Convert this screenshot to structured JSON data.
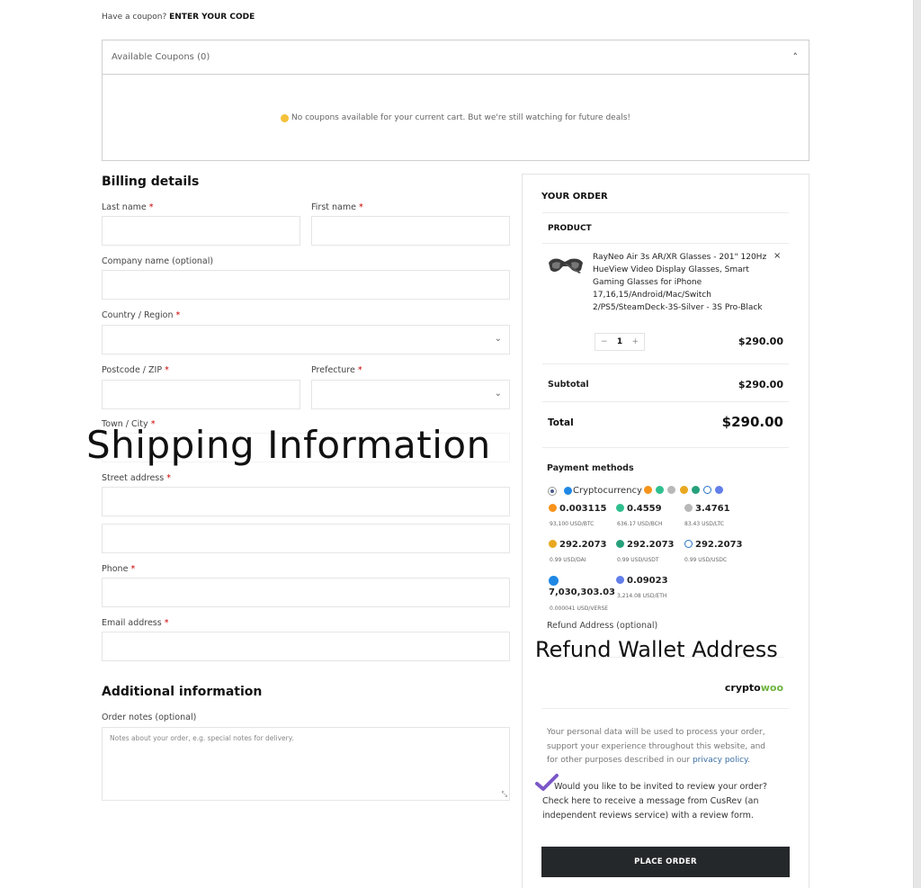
{
  "coupon": {
    "prompt": "Have a coupon?",
    "link": "ENTER YOUR CODE",
    "available_label": "Available Coupons (0)",
    "empty_message": "No coupons available for your current cart. But we're still watching for future deals!"
  },
  "billing": {
    "title": "Billing details",
    "last_name": "Last name",
    "first_name": "First name",
    "company": "Company name (optional)",
    "country": "Country / Region",
    "postcode": "Postcode / ZIP",
    "prefecture": "Prefecture",
    "town": "Town / City",
    "street": "Street address",
    "phone": "Phone",
    "email": "Email address",
    "required_mark": "*"
  },
  "overlays": {
    "shipping": "Shipping Information",
    "refund": "Refund Wallet Address"
  },
  "additional": {
    "title": "Additional information",
    "notes_label": "Order notes (optional)",
    "notes_placeholder": "Notes about your order, e.g. special notes for delivery."
  },
  "order": {
    "title": "YOUR ORDER",
    "product_header": "PRODUCT",
    "product_name": "RayNeo Air 3s AR/XR Glasses - 201\" 120Hz HueView Video Display Glasses, Smart Gaming Glasses for iPhone 17,16,15/Android/Mac/Switch 2/PS5/SteamDeck-3S-Silver - 3S Pro-Black",
    "remove": "×",
    "qty": "1",
    "minus": "−",
    "plus": "+",
    "price": "$290.00",
    "subtotal_label": "Subtotal",
    "subtotal_value": "$290.00",
    "total_label": "Total",
    "total_value": "$290.00"
  },
  "payment": {
    "title": "Payment methods",
    "method": "Cryptocurrency",
    "coins": [
      {
        "amount": "0.003115",
        "rate": "93,100 USD/BTC",
        "color": "#f7931a"
      },
      {
        "amount": "0.4559",
        "rate": "636.17 USD/BCH",
        "color": "#2fbf8f"
      },
      {
        "amount": "3.4761",
        "rate": "83.43 USD/LTC",
        "color": "#b8b8b8"
      },
      {
        "amount": "292.2073",
        "rate": "0.99 USD/DAI",
        "color": "#e9a820"
      },
      {
        "amount": "292.2073",
        "rate": "0.99 USD/USDT",
        "color": "#26a17b"
      },
      {
        "amount": "292.2073",
        "rate": "0.99 USD/USDC",
        "color": "#2775ca"
      },
      {
        "amount": "7,030,303.03",
        "rate": "0.000041 USD/VERSE",
        "color": "#1e88e5"
      },
      {
        "amount": "0.09023",
        "rate": "3,214.08 USD/ETH",
        "color": "#627eea"
      }
    ],
    "refund_label": "Refund Address (optional)",
    "brand_a": "crypto",
    "brand_b": "woo"
  },
  "privacy": {
    "text": "Your personal data will be used to process your order, support your experience throughout this website, and for other purposes described in our",
    "link": "privacy policy",
    "end": "."
  },
  "review": {
    "text": "Would you like to be invited to review your order? Check here to receive a message from CusRev (an independent reviews service) with a review form."
  },
  "place_order": "PLACE ORDER",
  "colors": {
    "button": "#25282b",
    "required": "#cc0000",
    "brand_green": "#6db33f",
    "check": "#7b57c8"
  }
}
